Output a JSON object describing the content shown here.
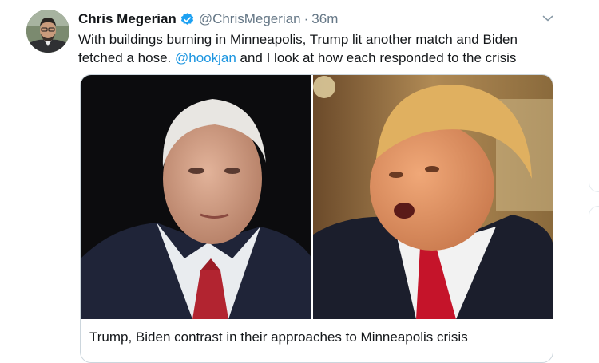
{
  "tweet": {
    "author_name": "Chris Megerian",
    "handle": "@ChrisMegerian",
    "separator": "·",
    "timestamp": "36m",
    "text_before": "With buildings burning in Minneapolis, Trump lit another match and Biden fetched a hose. ",
    "mention": "@hookjan",
    "text_after": " and I look at how each responded to the crisis"
  },
  "card": {
    "title": "Trump, Biden contrast in their approaches to Minneapolis crisis"
  },
  "icons": {
    "verified": "verified-badge-icon",
    "more": "chevron-down-icon"
  },
  "colors": {
    "verified_blue": "#1da1f2",
    "link_blue": "#1b95e0",
    "secondary_text": "#657786"
  }
}
